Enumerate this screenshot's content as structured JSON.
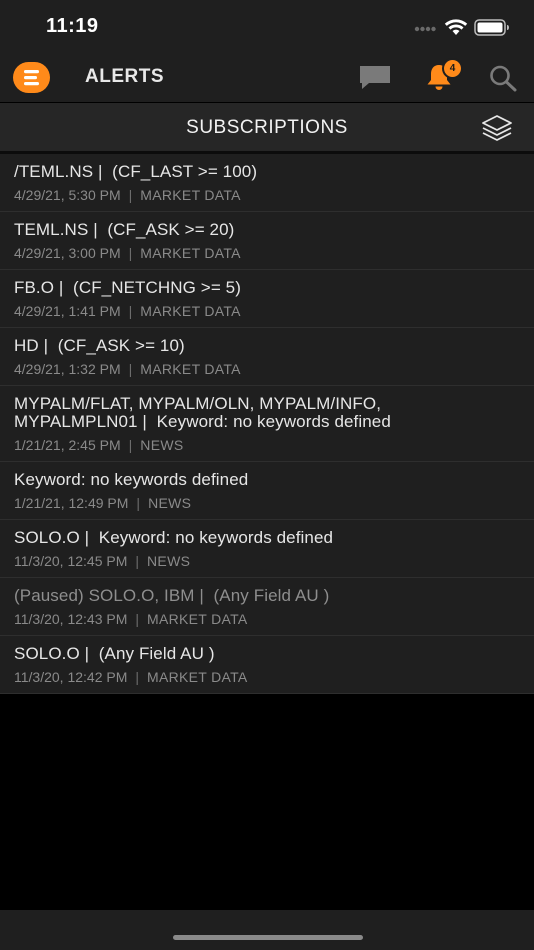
{
  "status_bar": {
    "time": "11:19"
  },
  "header": {
    "title": "ALERTS",
    "notification_count": "4",
    "icons": [
      "menu-logo",
      "chat-icon",
      "bell-icon",
      "search-icon"
    ],
    "accent_color": "#ff8a1a"
  },
  "subscriptions_bar": {
    "title": "SUBSCRIPTIONS",
    "icon": "layers-icon"
  },
  "subscriptions": [
    {
      "title": "/TEML.NS |  (CF_LAST >= 100)",
      "date": "4/29/21, 5:30 PM",
      "type": "MARKET DATA",
      "paused": false
    },
    {
      "title": "TEML.NS |  (CF_ASK >= 20)",
      "date": "4/29/21, 3:00 PM",
      "type": "MARKET DATA",
      "paused": false
    },
    {
      "title": "FB.O |  (CF_NETCHNG >= 5)",
      "date": "4/29/21, 1:41 PM",
      "type": "MARKET DATA",
      "paused": false
    },
    {
      "title": "HD |  (CF_ASK >= 10)",
      "date": "4/29/21, 1:32 PM",
      "type": "MARKET DATA",
      "paused": false
    },
    {
      "title": "MYPALM/FLAT, MYPALM/OLN, MYPALM/INFO,\nMYPALMPLN01 |  Keyword: no keywords defined",
      "date": "1/21/21, 2:45 PM",
      "type": "NEWS",
      "paused": false
    },
    {
      "title": "Keyword: no keywords defined",
      "date": "1/21/21, 12:49 PM",
      "type": "NEWS",
      "paused": false
    },
    {
      "title": "SOLO.O |  Keyword: no keywords defined",
      "date": "11/3/20, 12:45 PM",
      "type": "NEWS",
      "paused": false
    },
    {
      "title": "(Paused) SOLO.O, IBM |  (Any Field AU )",
      "date": "11/3/20, 12:43 PM",
      "type": "MARKET DATA",
      "paused": true
    },
    {
      "title": "SOLO.O |  (Any Field AU )",
      "date": "11/3/20, 12:42 PM",
      "type": "MARKET DATA",
      "paused": false
    }
  ]
}
